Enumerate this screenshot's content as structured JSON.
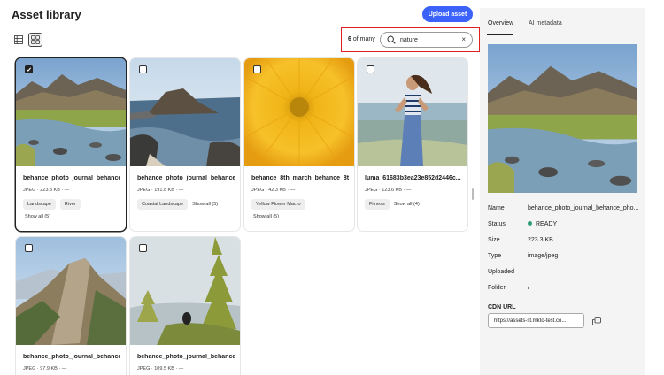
{
  "header": {
    "title": "Asset library",
    "upload_label": "Upload asset"
  },
  "view_toggle": {
    "list_icon": "list-view-icon",
    "grid_icon": "grid-view-icon",
    "active": "grid"
  },
  "search": {
    "count_number": "6",
    "count_suffix": " of many",
    "value": "nature",
    "clear_label": "×"
  },
  "assets": [
    {
      "name": "behance_photo_journal_behance_",
      "meta": "JPEG · 223.3 KB · —",
      "tags": [
        "Landscape",
        "River"
      ],
      "show_all": "Show all (5)",
      "selected": true
    },
    {
      "name": "behance_photo_journal_behance_",
      "meta": "JPEG · 191.8 KB · —",
      "tags": [
        "Coastal Landscape"
      ],
      "show_all": "Show all (5)",
      "selected": false
    },
    {
      "name": "behance_8th_march_behance_8tl",
      "meta": "JPEG · 42.3 KB · —",
      "tags": [
        "Yellow Flower Macro"
      ],
      "show_all": "Show all (5)",
      "selected": false
    },
    {
      "name": "luma_61683b3ea23e852d2446c...",
      "meta": "JPEG · 123.6 KB · —",
      "tags": [
        "Fitness"
      ],
      "show_all": "Show all (4)",
      "selected": false
    },
    {
      "name": "behance_photo_journal_behance_",
      "meta": "JPEG · 97.9 KB · —",
      "tags": [],
      "show_all": "",
      "selected": false
    },
    {
      "name": "behance_photo_journal_behance_",
      "meta": "JPEG · 109.5 KB · —",
      "tags": [],
      "show_all": "",
      "selected": false
    }
  ],
  "panel": {
    "tabs": [
      {
        "label": "Overview",
        "active": true
      },
      {
        "label": "AI metadata",
        "active": false
      }
    ],
    "properties": [
      {
        "label": "Name",
        "value": "behance_photo_journal_behance_pho..."
      },
      {
        "label": "Status",
        "value": "READY"
      },
      {
        "label": "Size",
        "value": "223.3 KB"
      },
      {
        "label": "Type",
        "value": "image/jpeg"
      },
      {
        "label": "Uploaded",
        "value": "—"
      },
      {
        "label": "Folder",
        "value": "/"
      }
    ],
    "cdn_label": "CDN URL",
    "cdn_value": "https://assets-st.mkto-test.co...",
    "status_color": "#2d9d78"
  },
  "colors": {
    "accent": "#3b63fb",
    "highlight": "#e02020"
  }
}
